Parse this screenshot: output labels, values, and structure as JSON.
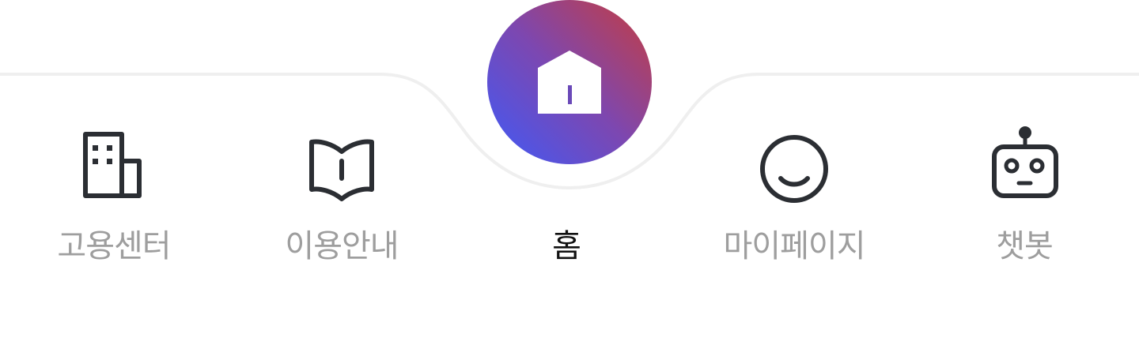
{
  "nav": {
    "items": [
      {
        "label": "고용센터",
        "icon": "building-icon"
      },
      {
        "label": "이용안내",
        "icon": "book-icon"
      },
      {
        "label": "홈",
        "icon": "home-icon",
        "active": true
      },
      {
        "label": "마이페이지",
        "icon": "smile-icon"
      },
      {
        "label": "챗봇",
        "icon": "robot-icon"
      }
    ]
  },
  "colors": {
    "label_inactive": "#9e9e9e",
    "label_active": "#111111",
    "icon_stroke": "#2b2e33",
    "fab_gradient_start": "#3f5af7",
    "fab_gradient_end": "#c63d3f",
    "home_door": "#6a49b8"
  }
}
